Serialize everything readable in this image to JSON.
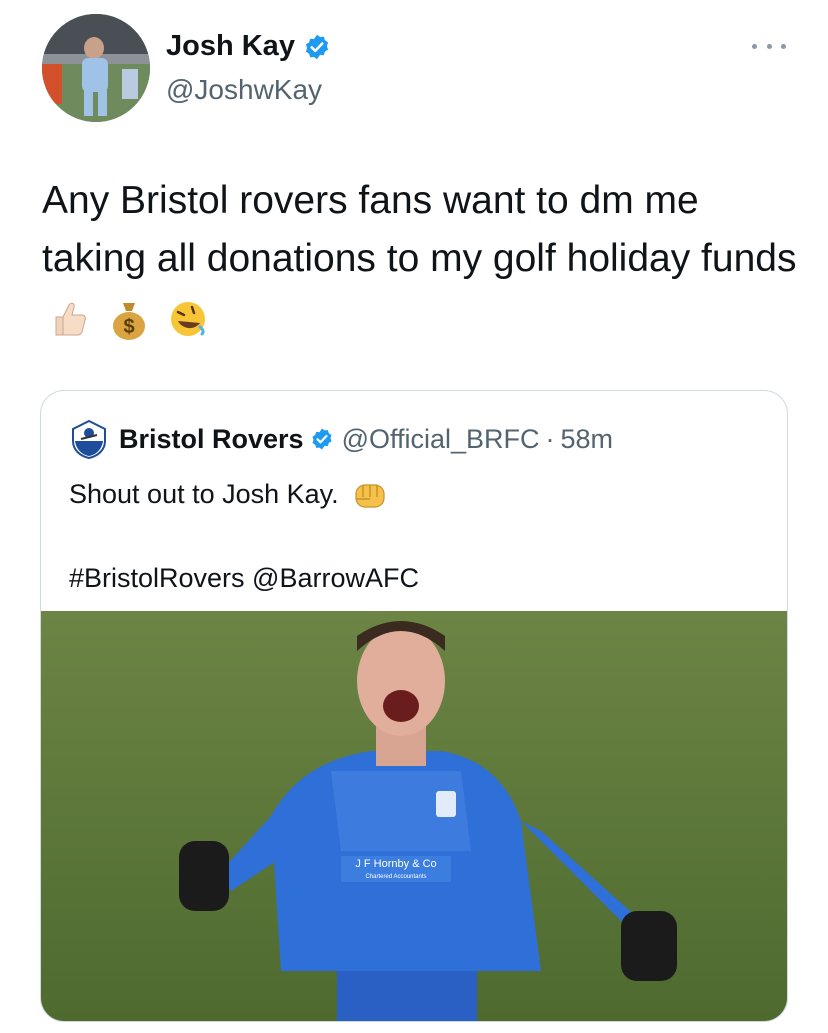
{
  "author": {
    "name": "Josh Kay",
    "handle": "@JoshwKay"
  },
  "tweet": {
    "text": "Any Bristol rovers fans want to dm me taking all donations to my golf holiday funds",
    "emojis": [
      "thumbs-up-light-skin",
      "money-bag",
      "rolling-on-floor-laughing"
    ]
  },
  "quoted_tweet": {
    "name": "Bristol Rovers",
    "handle": "@Official_BRFC",
    "separator": "·",
    "time": "58m",
    "text_line1": "Shout out to Josh Kay.",
    "text_line1_emoji": "oncoming-fist",
    "hashtags_line": "#BristolRovers @BarrowAFC",
    "photo": {
      "shirt_sponsor_line1": "J F Hornby & Co",
      "shirt_sponsor_line2": "Chartered Accountants"
    }
  },
  "colors": {
    "verified": "#1d9bf0",
    "text_primary": "#0f1419",
    "text_secondary": "#536471",
    "border": "#cfd9de",
    "pitch": "#5f7a3c",
    "shirt": "#2f6fd8"
  }
}
